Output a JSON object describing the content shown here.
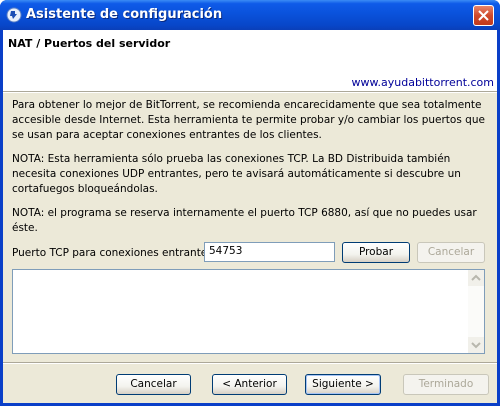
{
  "window": {
    "title": "Asistente de configuración"
  },
  "header": {
    "title": "NAT / Puertos del servidor",
    "link": "www.ayudabittorrent.com"
  },
  "body": {
    "paragraph1": "Para obtener lo mejor de BitTorrent, se recomienda encarecidamente que sea totalmente accesible desde Internet. Esta herramienta te permite probar y/o cambiar los puertos que se usan para aceptar conexiones entrantes de los clientes.",
    "paragraph2": "NOTA: Esta herramienta sólo prueba las conexiones TCP. La BD Distribuida también necesita conexiones UDP entrantes, pero te avisará automáticamente si descubre un cortafuegos bloqueándolas.",
    "paragraph3": "NOTA: el programa se reserva internamente el puerto TCP 6880, así que no puedes usar éste.",
    "port_label": "Puerto TCP para conexiones entrantes",
    "port_value": "54753",
    "probar_label": "Probar",
    "cancelar_test_label": "Cancelar",
    "output_text": ""
  },
  "footer": {
    "cancel_label": "Cancelar",
    "back_label": "< Anterior",
    "next_label": "Siguiente >",
    "finish_label": "Terminado"
  },
  "colors": {
    "titlebar": "#0a52dc",
    "link": "#000099",
    "dialog_bg": "#ece9d8"
  }
}
